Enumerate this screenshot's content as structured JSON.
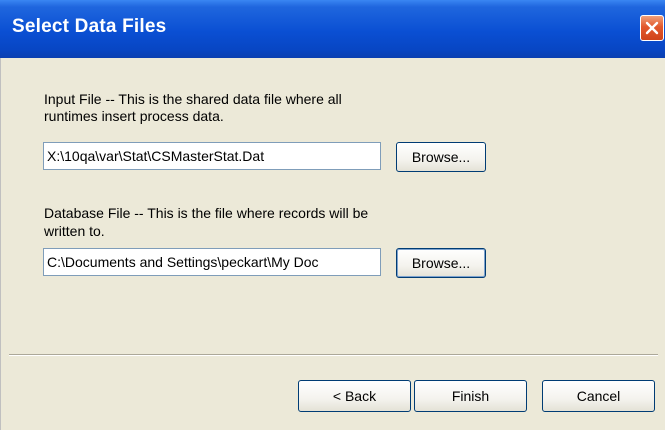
{
  "window": {
    "title": "Select Data Files"
  },
  "input_file": {
    "label_line1": "Input File -- This is the shared data file where all",
    "label_line2": "runtimes insert process data.",
    "value": "X:\\10qa\\var\\Stat\\CSMasterStat.Dat",
    "browse_label": "Browse..."
  },
  "database_file": {
    "label_line1": "Database File -- This is the file where records will be",
    "label_line2": "written to.",
    "value": "C:\\Documents and Settings\\peckart\\My Doc",
    "browse_label": "Browse..."
  },
  "footer": {
    "back_label": "< Back",
    "finish_label": "Finish",
    "cancel_label": "Cancel"
  },
  "icons": {
    "close": "close-icon"
  },
  "colors": {
    "titlebar": "#0a4fd3",
    "close_button": "#e2582c",
    "dialog_background": "#ece9d8",
    "field_border": "#7f9db9",
    "button_border": "#003c74"
  }
}
